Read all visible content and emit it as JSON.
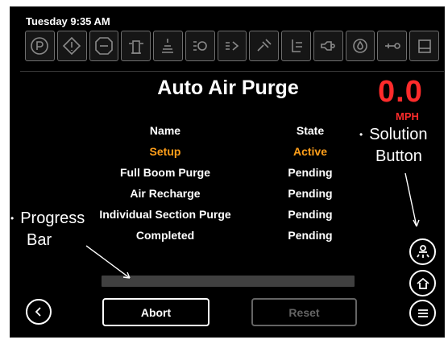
{
  "status": {
    "datetime": "Tuesday 9:35 AM",
    "icons": [
      "parking-brake-icon",
      "warning-diamond-icon",
      "stop-octagon-icon",
      "tank-icon",
      "fluid-level-icon",
      "hydraulic-icon",
      "pressure-icon",
      "service-icon",
      "sprayer-icon",
      "engine-icon",
      "oil-icon",
      "boom-icon",
      "fuel-tank-icon"
    ]
  },
  "main": {
    "title": "Auto Air Purge",
    "speed": {
      "value": "0.0",
      "unit": "MPH"
    },
    "table": {
      "headers": {
        "name": "Name",
        "state": "State"
      },
      "rows": [
        {
          "name": "Setup",
          "state": "Active",
          "active": true
        },
        {
          "name": "Full Boom Purge",
          "state": "Pending",
          "active": false
        },
        {
          "name": "Air Recharge",
          "state": "Pending",
          "active": false
        },
        {
          "name": "Individual Section Purge",
          "state": "Pending",
          "active": false
        },
        {
          "name": "Completed",
          "state": "Pending",
          "active": false
        }
      ]
    },
    "progress": 0
  },
  "buttons": {
    "abort": "Abort",
    "reset": "Reset",
    "back_icon": "left-arrow-icon",
    "solution_icon": "solution-icon",
    "home_icon": "home-icon",
    "menu_icon": "menu-icon"
  },
  "callouts": {
    "solution": {
      "line1": "Solution",
      "line2": "Button"
    },
    "progress": {
      "line1": "Progress",
      "line2": "Bar"
    }
  },
  "colors": {
    "screen_background": "#000000",
    "speed": "#ff2b2b",
    "active_row": "#ff9f1a",
    "text": "#ffffff",
    "disabled": "#646464"
  }
}
